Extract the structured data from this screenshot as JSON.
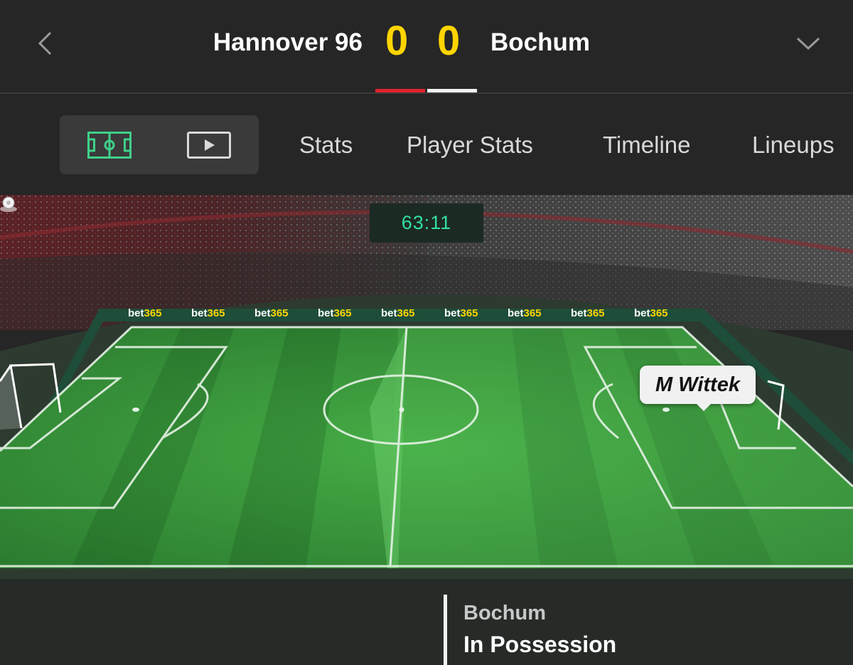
{
  "match": {
    "home_team": "Hannover 96",
    "away_team": "Bochum",
    "home_score": "0",
    "away_score": "0",
    "home_kit_color": "#e0222e",
    "away_kit_color": "#f2f2f2"
  },
  "nav": {
    "back_icon": "back-chevron-icon",
    "expand_icon": "chevron-down-icon"
  },
  "view_toggle": {
    "pitch_icon": "pitch-icon",
    "video_icon": "video-play-icon",
    "active": "pitch"
  },
  "tabs": [
    {
      "label": "Stats"
    },
    {
      "label": "Player Stats"
    },
    {
      "label": "Timeline"
    },
    {
      "label": "Lineups"
    }
  ],
  "pitch": {
    "clock": "63:11",
    "clock_color": "#33e0a1",
    "board_text": "bet365",
    "player_label": "M Wittek",
    "possession_team": "Bochum",
    "possession_status": "In Possession"
  },
  "colors": {
    "accent_score": "#FFD500",
    "background": "#262626",
    "pitch_green": "#3f9e3f"
  }
}
